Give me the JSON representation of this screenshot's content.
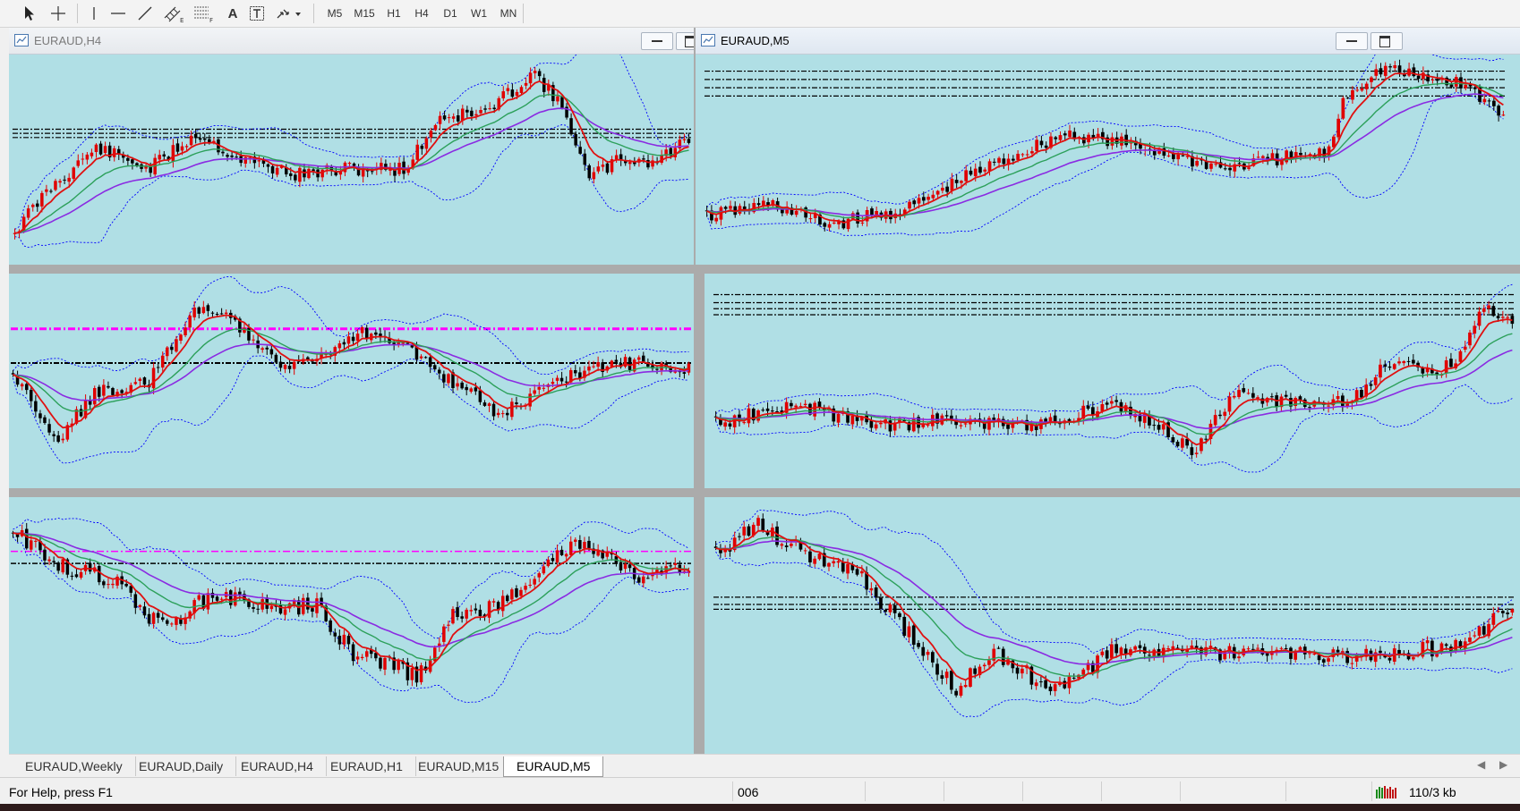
{
  "toolbar": {
    "tools": [
      {
        "name": "cursor-icon"
      },
      {
        "name": "crosshair-icon"
      },
      {
        "name": "vertical-line-icon"
      },
      {
        "name": "horizontal-line-icon"
      },
      {
        "name": "trendline-icon"
      },
      {
        "name": "equidistant-channel-icon"
      },
      {
        "name": "fibonacci-retracement-icon"
      },
      {
        "name": "text-tool-icon",
        "label": "A"
      },
      {
        "name": "text-label-icon",
        "label": "T"
      },
      {
        "name": "arrows-dropdown-icon"
      }
    ],
    "timeframes": [
      "M5",
      "M15",
      "H1",
      "H4",
      "D1",
      "W1",
      "MN"
    ]
  },
  "windows": [
    {
      "title": "EURAUD,H4",
      "active": false
    },
    {
      "title": "EURAUD,M5",
      "active": true
    }
  ],
  "tabs": [
    "EURAUD,Weekly",
    "EURAUD,Daily",
    "EURAUD,H4",
    "EURAUD,H1",
    "EURAUD,M15",
    "EURAUD,M5"
  ],
  "active_tab": "EURAUD,M5",
  "status": {
    "help": "For Help, press F1",
    "profile": "006",
    "traffic": "110/3 kb"
  },
  "colors": {
    "chart_bg": "#b0dfe5",
    "bull_candle": "#e00000",
    "bear_candle": "#000000",
    "ma_fast": "#e01010",
    "ma_mid": "#2ca05a",
    "ma_slow": "#8a2be2",
    "bands": "#0000ff",
    "level_magenta": "#ff00ff"
  }
}
